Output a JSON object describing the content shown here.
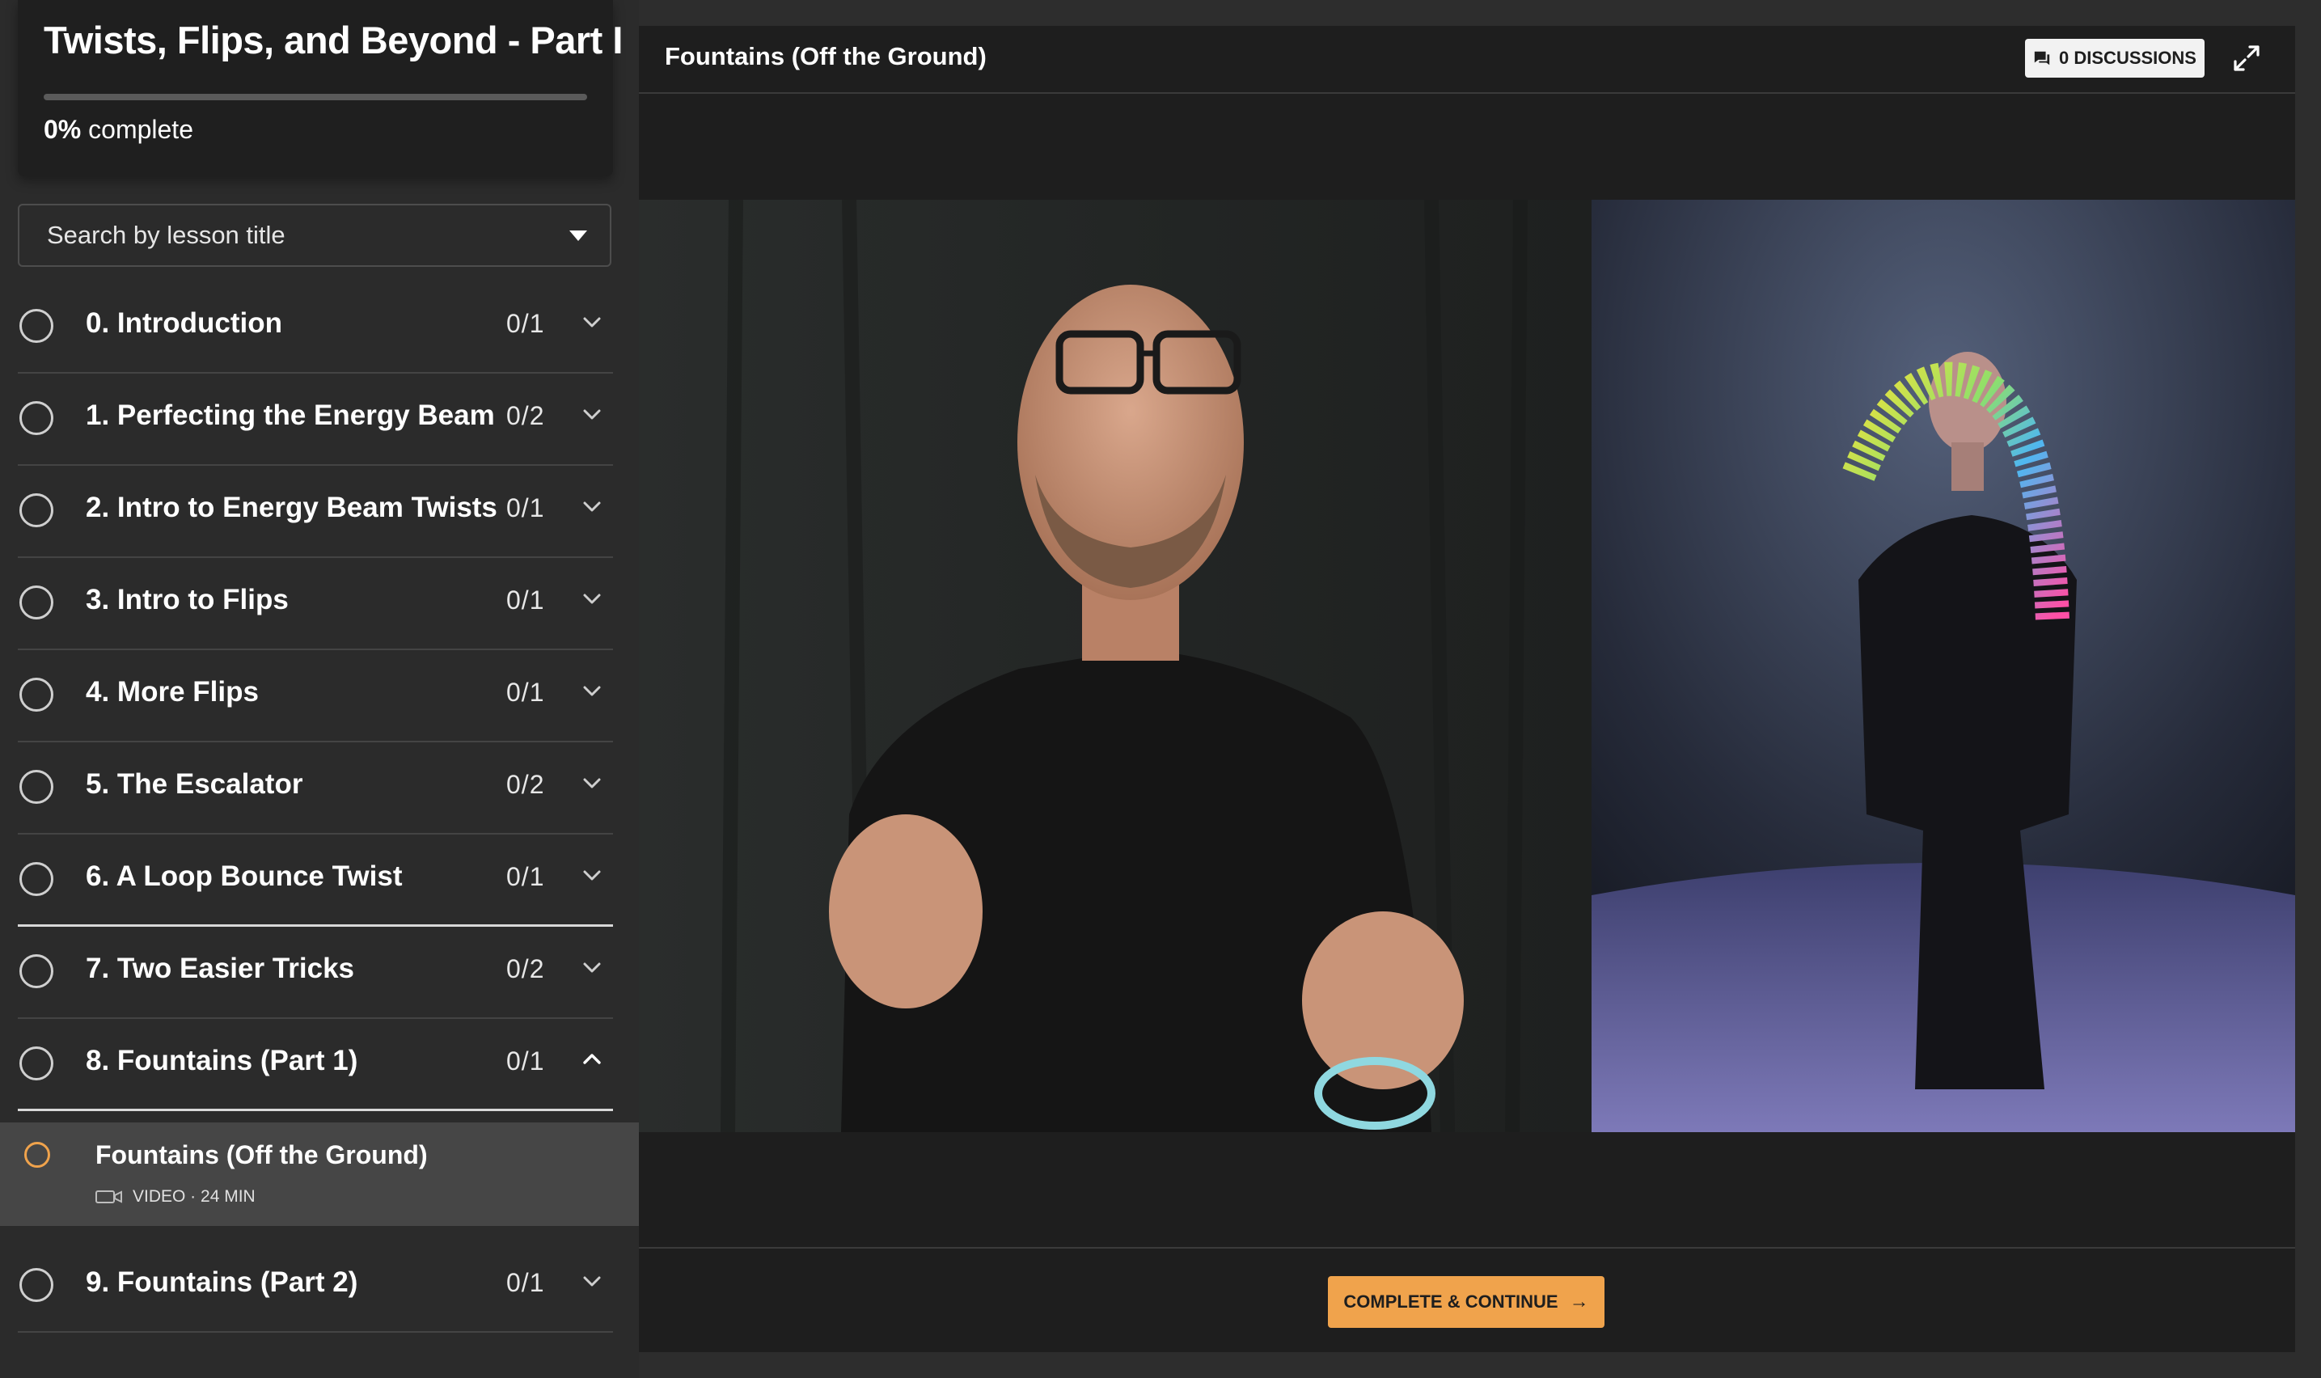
{
  "course": {
    "title": "Twists, Flips, and Beyond - Part I",
    "progress_value": "0%",
    "progress_suffix": " complete",
    "progress_fraction": 0
  },
  "search": {
    "placeholder": "Search by lesson title"
  },
  "sections": [
    {
      "title": "0. Introduction",
      "count": "0/1",
      "expanded": false
    },
    {
      "title": "1. Perfecting the Energy Beam",
      "count": "0/2",
      "expanded": false
    },
    {
      "title": "2. Intro to Energy Beam Twists",
      "count": "0/1",
      "expanded": false
    },
    {
      "title": "3. Intro to Flips",
      "count": "0/1",
      "expanded": false
    },
    {
      "title": "4. More Flips",
      "count": "0/1",
      "expanded": false
    },
    {
      "title": "5. The Escalator",
      "count": "0/2",
      "expanded": false
    },
    {
      "title": "6. A Loop Bounce Twist",
      "count": "0/1",
      "expanded": false
    },
    {
      "title": "7. Two Easier Tricks",
      "count": "0/2",
      "expanded": false
    },
    {
      "title": "8. Fountains (Part 1)",
      "count": "0/1",
      "expanded": true
    },
    {
      "title": "9. Fountains (Part 2)",
      "count": "0/1",
      "expanded": false
    }
  ],
  "current_lesson": {
    "title": "Fountains (Off the Ground)",
    "meta": "VIDEO · 24 MIN",
    "icon": "video-camera-icon"
  },
  "header": {
    "title": "Fountains (Off the Ground)",
    "discussions_label": "0 DISCUSSIONS",
    "fullscreen_icon": "expand-icon"
  },
  "footer": {
    "complete_label": "COMPLETE & CONTINUE",
    "complete_arrow": "→"
  },
  "colors": {
    "accent": "#f0a34c",
    "panel": "#1e1e1e",
    "sidebar": "#2b2b2b"
  }
}
